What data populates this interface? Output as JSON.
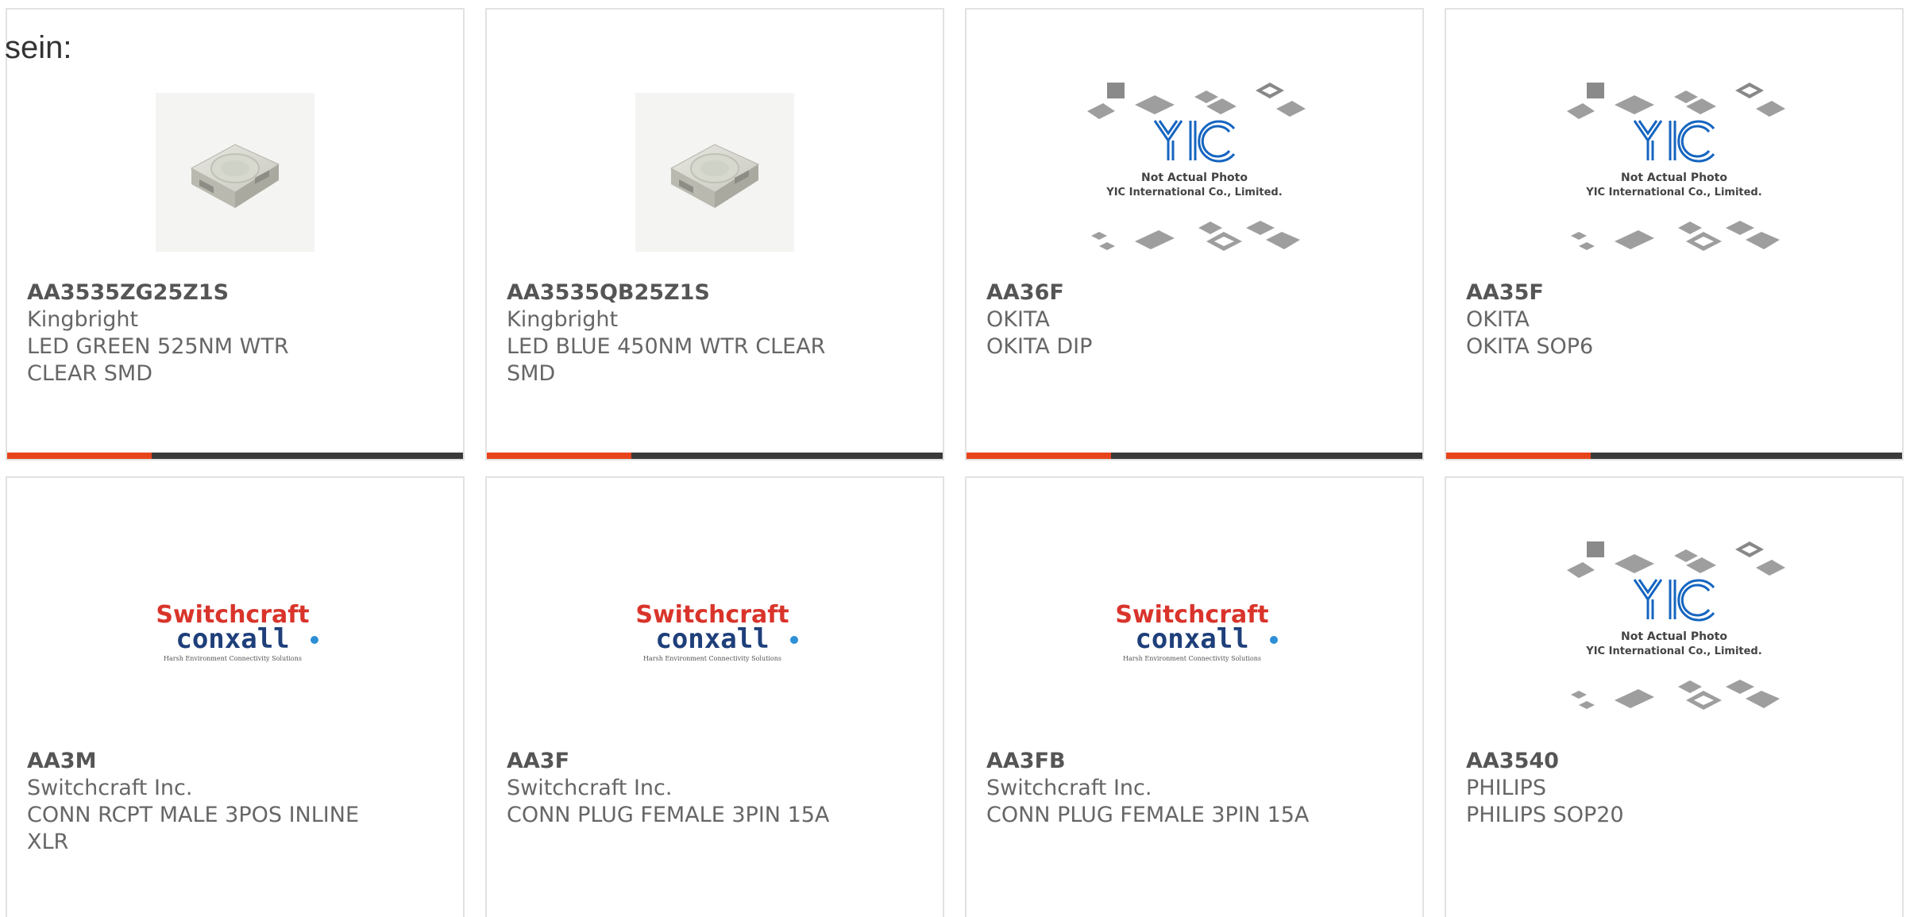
{
  "intro": {
    "text": "sein:"
  },
  "colors": {
    "accent": "#e8441c",
    "bar": "#3a3a3a",
    "switchcraft_red": "#d9342b",
    "conxall_blue": "#1e3f7a",
    "yic_blue": "#1565c0"
  },
  "products": [
    {
      "part": "AA3535ZG25Z1S",
      "maker": "Kingbright",
      "desc": "LED GREEN 525NM WTR CLEAR SMD",
      "image": "led-smd-photo"
    },
    {
      "part": "AA3535QB25Z1S",
      "maker": "Kingbright",
      "desc": "LED BLUE 450NM WTR CLEAR SMD",
      "image": "led-smd-photo"
    },
    {
      "part": "AA36F",
      "maker": "OKITA",
      "desc": "OKITA DIP",
      "image": "yic-placeholder",
      "image_text": {
        "line1": "Not Actual Photo",
        "line2": "YIC International Co., Limited."
      }
    },
    {
      "part": "AA35F",
      "maker": "OKITA",
      "desc": "OKITA SOP6",
      "image": "yic-placeholder",
      "image_text": {
        "line1": "Not Actual Photo",
        "line2": "YIC International Co., Limited."
      }
    },
    {
      "part": "AA3M",
      "maker": "Switchcraft Inc.",
      "desc": "CONN RCPT MALE 3POS INLINE XLR",
      "image": "switchcraft-logo",
      "logo_text": {
        "top": "Switchcraft",
        "bottom": "conxall",
        "tagline": "Harsh Environment Connectivity Solutions"
      }
    },
    {
      "part": "AA3F",
      "maker": "Switchcraft Inc.",
      "desc": "CONN PLUG FEMALE 3PIN 15A",
      "image": "switchcraft-logo",
      "logo_text": {
        "top": "Switchcraft",
        "bottom": "conxall",
        "tagline": "Harsh Environment Connectivity Solutions"
      }
    },
    {
      "part": "AA3FB",
      "maker": "Switchcraft Inc.",
      "desc": "CONN PLUG FEMALE 3PIN 15A",
      "image": "switchcraft-logo",
      "logo_text": {
        "top": "Switchcraft",
        "bottom": "conxall",
        "tagline": "Harsh Environment Connectivity Solutions"
      }
    },
    {
      "part": "AA3540",
      "maker": "PHILIPS",
      "desc": "PHILIPS SOP20",
      "image": "yic-placeholder",
      "image_text": {
        "line1": "Not Actual Photo",
        "line2": "YIC International Co., Limited."
      }
    }
  ]
}
